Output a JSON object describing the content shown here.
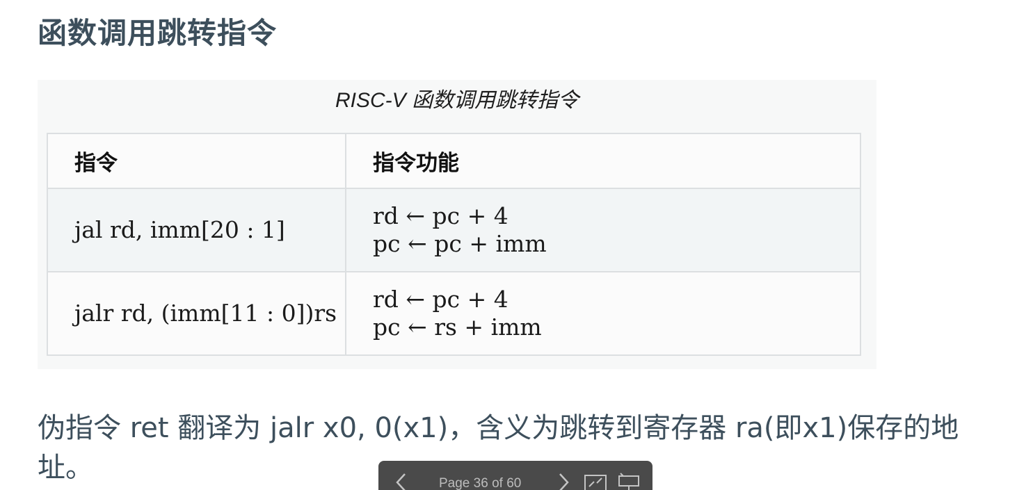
{
  "slide": {
    "title": "函数调用跳转指令"
  },
  "table": {
    "caption": "RISC-V 函数调用跳转指令",
    "headers": [
      "指令",
      "指令功能"
    ],
    "rows": [
      {
        "instruction": "jal rd,  imm[20 : 1]",
        "function": [
          "rd ← pc + 4",
          "pc ← pc + imm"
        ]
      },
      {
        "instruction": "jalr rd,  (imm[11 : 0])rs",
        "function": [
          "rd ← pc + 4",
          "pc ← rs + imm"
        ]
      }
    ]
  },
  "body": {
    "paragraph": "伪指令 ret 翻译为 jalr x0, 0(x1)，含义为跳转到寄存器 ra(即x1)保存的地址。"
  },
  "nav": {
    "page_label": "Page 36 of 60",
    "icons": [
      "chevron-left-icon",
      "chevron-right-icon",
      "fullscreen-icon",
      "presentation-icon"
    ]
  }
}
